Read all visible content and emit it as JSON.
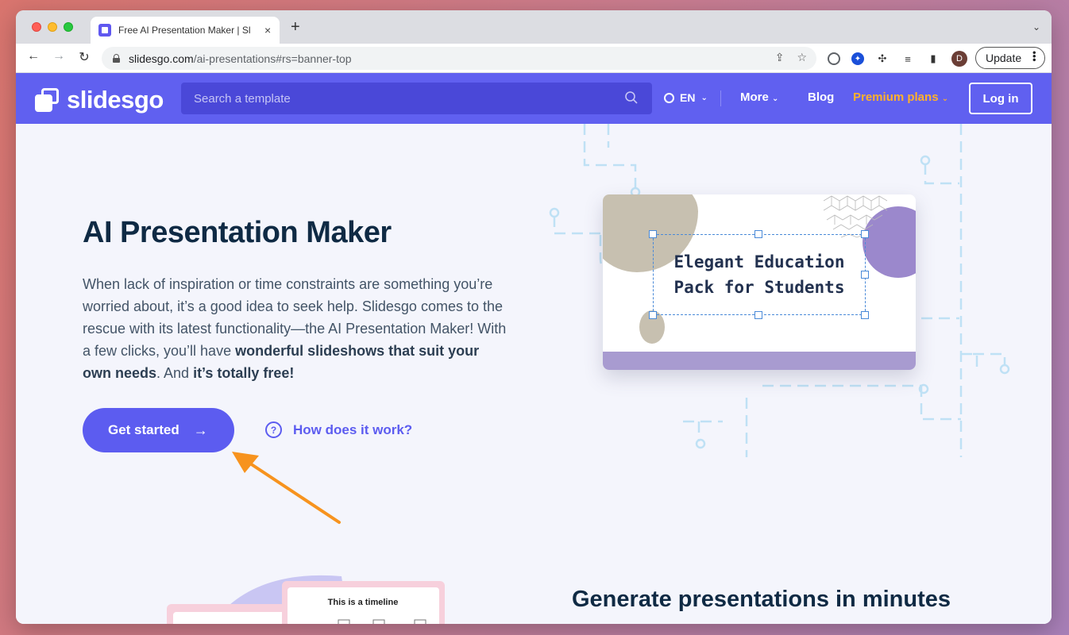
{
  "browser": {
    "tab_title": "Free AI Presentation Maker | Sl",
    "new_tab": "+",
    "close": "×",
    "url_domain": "slidesgo.com",
    "url_path": "/ai-presentations#rs=banner-top",
    "avatar_letter": "D",
    "update_label": "Update"
  },
  "header": {
    "logo_text": "slidesgo",
    "search_placeholder": "Search a template",
    "lang": "EN",
    "more": "More",
    "blog": "Blog",
    "premium": "Premium plans",
    "login": "Log in"
  },
  "hero": {
    "title": "AI Presentation Maker",
    "desc_1": "When lack of inspiration or time constraints are something you’re worried about, it’s a good idea to seek help. Slidesgo comes to the rescue with its latest functionality—the AI Presentation Maker! With a few clicks, you’ll have ",
    "desc_bold_1": "wonderful slideshows that suit your own needs",
    "desc_2": ". And ",
    "desc_bold_2": "it’s totally free!",
    "cta": "Get started",
    "how": "How does it work?",
    "slide_line_1": "Elegant Education",
    "slide_line_2": "Pack for Students"
  },
  "lower": {
    "title": "Generate presentations in minutes",
    "timeline_label": "This is a timeline"
  },
  "colors": {
    "brand": "#6060f0",
    "premium": "#ffb12b",
    "annotation_arrow": "#f7931e"
  }
}
